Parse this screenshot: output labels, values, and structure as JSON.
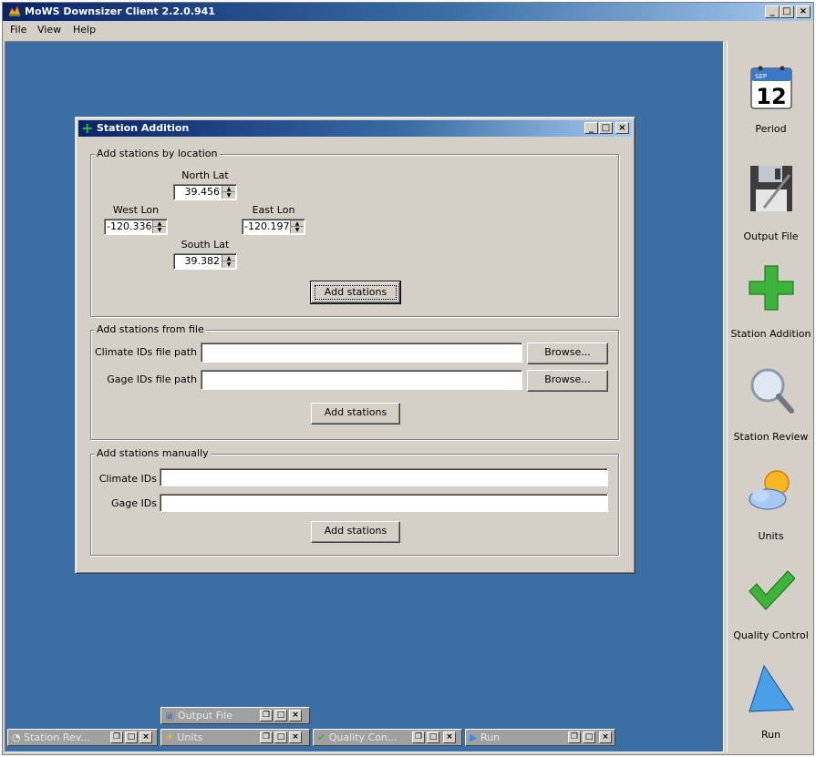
{
  "window": {
    "title": "MoWS Downsizer Client 2.2.0.941",
    "controls": [
      "_",
      "□",
      "×"
    ]
  },
  "menu": [
    "File",
    "View",
    "Help"
  ],
  "toolbar": [
    {
      "label": "Period",
      "icon": "calendar-icon",
      "calendar_month": "SEP",
      "calendar_day": "12"
    },
    {
      "label": "Output File",
      "icon": "floppy-disk-icon"
    },
    {
      "label": "Station Addition",
      "icon": "green-plus-icon"
    },
    {
      "label": "Station Review",
      "icon": "magnifier-icon"
    },
    {
      "label": "Units",
      "icon": "sun-cloud-icon"
    },
    {
      "label": "Quality Control",
      "icon": "checkmark-icon"
    },
    {
      "label": "Run",
      "icon": "play-triangle-icon"
    }
  ],
  "dialog": {
    "title": "Station Addition",
    "location_group": {
      "legend": "Add stations by location",
      "north_label": "North Lat",
      "north_value": "39.456",
      "west_label": "West Lon",
      "west_value": "-120.336",
      "east_label": "East Lon",
      "east_value": "-120.197",
      "south_label": "South Lat",
      "south_value": "39.382",
      "add_button": "Add stations"
    },
    "file_group": {
      "legend": "Add stations from file",
      "climate_label": "Climate IDs file path",
      "climate_value": "",
      "gage_label": "Gage IDs file path",
      "gage_value": "",
      "browse_button": "Browse...",
      "add_button": "Add stations"
    },
    "manual_group": {
      "legend": "Add stations manually",
      "climate_label": "Climate IDs",
      "climate_value": "",
      "gage_label": "Gage IDs",
      "gage_value": "",
      "add_button": "Add stations"
    }
  },
  "minimized_frames": [
    {
      "label": "Output File",
      "icon": "floppy-disk-icon"
    },
    {
      "label": "Station Rev...",
      "icon": "magnifier-icon"
    },
    {
      "label": "Units",
      "icon": "sun-cloud-icon"
    },
    {
      "label": "Quality Con...",
      "icon": "checkmark-icon"
    },
    {
      "label": "Run",
      "icon": "play-triangle-icon"
    }
  ],
  "colors": {
    "desktop": "#3a6ea5",
    "chrome": "#d4d0c8",
    "title_active": "#0a246a",
    "accent_green": "#2fbf2f"
  }
}
